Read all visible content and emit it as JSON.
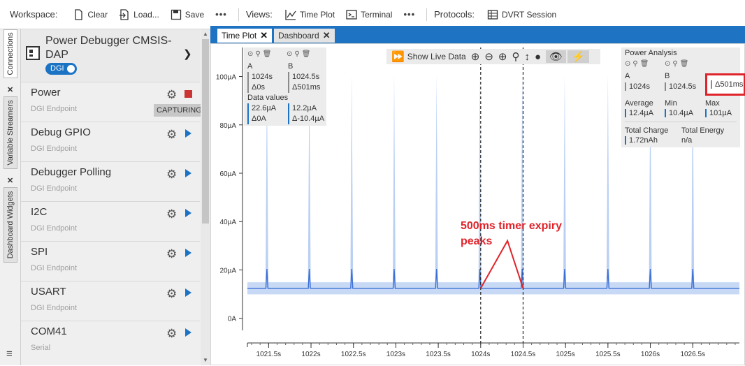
{
  "toolbar": {
    "workspace_label": "Workspace:",
    "clear_label": "Clear",
    "load_label": "Load...",
    "save_label": "Save",
    "more1": "•••",
    "views_label": "Views:",
    "timeplot_label": "Time Plot",
    "terminal_label": "Terminal",
    "more2": "•••",
    "protocols_label": "Protocols:",
    "dvrt_label": "DVRT Session"
  },
  "vtabs": [
    "Connections",
    "Variable Streamers",
    "Dashboard Widgets"
  ],
  "device": {
    "title": "Power Debugger CMSIS-DAP",
    "badge": "DGI"
  },
  "endpoints": [
    {
      "name": "Power",
      "sub": "DGI Endpoint",
      "state": "CAPTURING"
    },
    {
      "name": "Debug GPIO",
      "sub": "DGI Endpoint"
    },
    {
      "name": "Debugger Polling",
      "sub": "DGI Endpoint"
    },
    {
      "name": "I2C",
      "sub": "DGI Endpoint"
    },
    {
      "name": "SPI",
      "sub": "DGI Endpoint"
    },
    {
      "name": "USART",
      "sub": "DGI Endpoint"
    },
    {
      "name": "COM41",
      "sub": "Serial"
    }
  ],
  "tabs": [
    {
      "label": "Time Plot",
      "close": "✕"
    },
    {
      "label": "Dashboard",
      "close": "✕"
    }
  ],
  "live": {
    "label": "Show Live Data"
  },
  "cursors": {
    "a_label": "A",
    "b_label": "B",
    "a_time": "1024s",
    "a_delta": "Δ0s",
    "b_time": "1024.5s",
    "b_delta": "Δ501ms",
    "data_values_label": "Data values",
    "a_value": "22.6µA",
    "a_value_delta": "Δ0A",
    "b_value": "12.2µA",
    "b_value_delta": "Δ-10.4µA"
  },
  "power_analysis": {
    "title": "Power Analysis",
    "a_label": "A",
    "b_label": "B",
    "a_time": "1024s",
    "b_time": "1024.5s",
    "delta": "Δ501ms",
    "avg_label": "Average",
    "avg": "12.4µA",
    "min_label": "Min",
    "min": "10.4µA",
    "max_label": "Max",
    "max": "101µA",
    "charge_label": "Total Charge",
    "charge": "1.72nAh",
    "energy_label": "Total Energy",
    "energy": "n/a"
  },
  "annotation": {
    "line1": "500ms timer expiry",
    "line2": "peaks"
  },
  "chart_data": {
    "type": "line",
    "xlim": [
      1021.25,
      1027.05
    ],
    "ylim": [
      -5,
      112
    ],
    "yticks": [
      "0A",
      "20µA",
      "40µA",
      "60µA",
      "80µA",
      "100µA"
    ],
    "ytick_values": [
      0,
      20,
      40,
      60,
      80,
      100
    ],
    "xticks": [
      "1021.5s",
      "1022s",
      "1022.5s",
      "1023s",
      "1023.5s",
      "1024s",
      "1024.5s",
      "1025s",
      "1025.5s",
      "1026s",
      "1026.5s"
    ],
    "xtick_values": [
      1021.5,
      1022,
      1022.5,
      1023,
      1023.5,
      1024,
      1024.5,
      1025,
      1025.5,
      1026,
      1026.5
    ],
    "baseline": 12.4,
    "peak_times": [
      1021.48,
      1021.98,
      1022.48,
      1022.98,
      1023.48,
      1023.99,
      1024.49,
      1024.99,
      1025.5,
      1026.0,
      1026.5
    ],
    "peak_values": [
      101,
      101,
      101,
      101,
      101,
      101,
      101,
      101,
      101,
      101,
      101
    ],
    "cursor_a": 1024.0,
    "cursor_b": 1024.5,
    "colors": {
      "trace": "#3c6fd6",
      "envelope": "#b9d0f3",
      "cursor": "#222222"
    }
  },
  "colors": {
    "accent": "#1c73c4",
    "highlight": "#e0242b"
  }
}
